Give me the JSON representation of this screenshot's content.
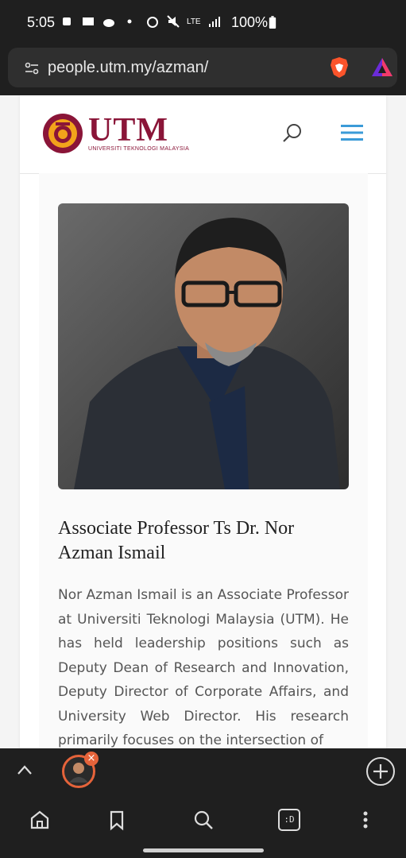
{
  "status_bar": {
    "time": "5:05",
    "battery": "100%",
    "network": "LTE"
  },
  "browser": {
    "url": "people.utm.my/azman/"
  },
  "site": {
    "logo_text": "UTM",
    "logo_subtitle": "UNIVERSITI TEKNOLOGI MALAYSIA",
    "colors": {
      "brand": "#8a1538",
      "accent": "#3b9bd8"
    }
  },
  "profile": {
    "name": "Associate Professor Ts Dr. Nor Azman Ismail",
    "bio": "Nor Azman Ismail is an Associate Professor at Universiti Teknologi Malaysia (UTM). He has held leadership positions such as Deputy Dean of Research and Innovation, Deputy Director of Corporate Affairs, and University Web Director. His research primarily focuses on the intersection of"
  },
  "tab_strip": {
    "close_symbol": "×"
  },
  "nav": {
    "tabs_label": ":D"
  }
}
